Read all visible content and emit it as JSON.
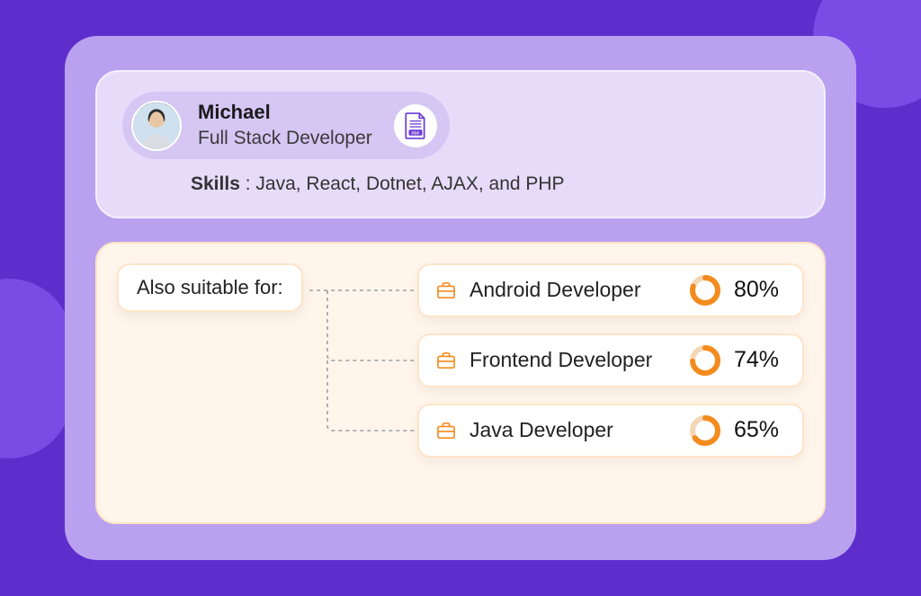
{
  "profile": {
    "name": "Michael",
    "role": "Full Stack Developer",
    "skills_label": "Skills",
    "skills_value": "Java, React, Dotnet, AJAX, and PHP"
  },
  "suitability": {
    "header": "Also suitable for:",
    "roles": [
      {
        "title": "Android Developer",
        "match_pct": 80
      },
      {
        "title": "Frontend Developer",
        "match_pct": 74
      },
      {
        "title": "Java Developer",
        "match_pct": 65
      }
    ]
  },
  "colors": {
    "accent_orange": "#F38B1E",
    "accent_purple": "#5E2ECC"
  }
}
